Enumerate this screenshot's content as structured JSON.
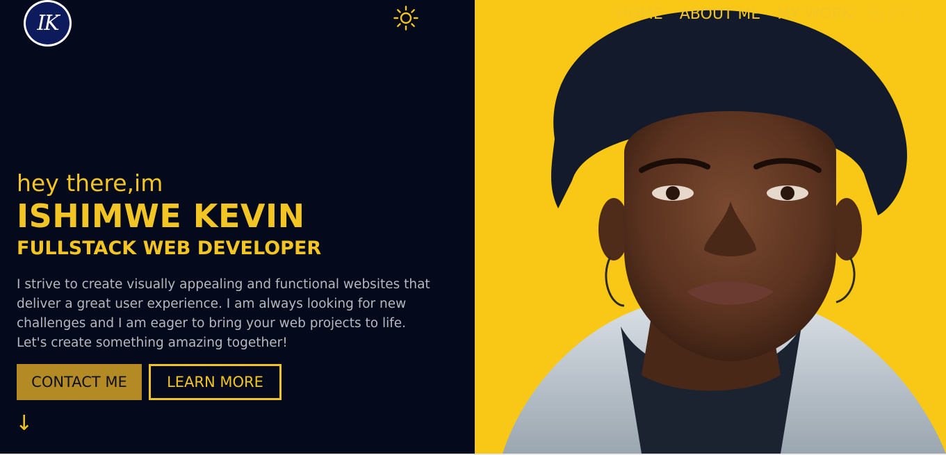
{
  "logo": {
    "text": "IK"
  },
  "header": {
    "theme_icon": "sun-icon",
    "nav": [
      {
        "label": "HOME"
      },
      {
        "label": "ABOUT ME"
      },
      {
        "label": "MY WORK"
      },
      {
        "label": "BLOGS"
      }
    ]
  },
  "hero": {
    "greeting": "hey there,im",
    "name": "ISHIMWE KEVIN",
    "role": "FULLSTACK WEB DEVELOPER",
    "description": "I strive to create visually appealing and functional websites that deliver a great user experience. I am always looking for new challenges and I am eager to bring your web projects to life. Let's create something amazing together!",
    "contact_label": "CONTACT ME",
    "learn_label": "LEARN MORE",
    "scroll_icon": "arrow-down-icon"
  },
  "colors": {
    "background": "#040a1c",
    "accent": "#f3c524",
    "panel": "#f9c816",
    "button_fill": "#b48a25"
  }
}
